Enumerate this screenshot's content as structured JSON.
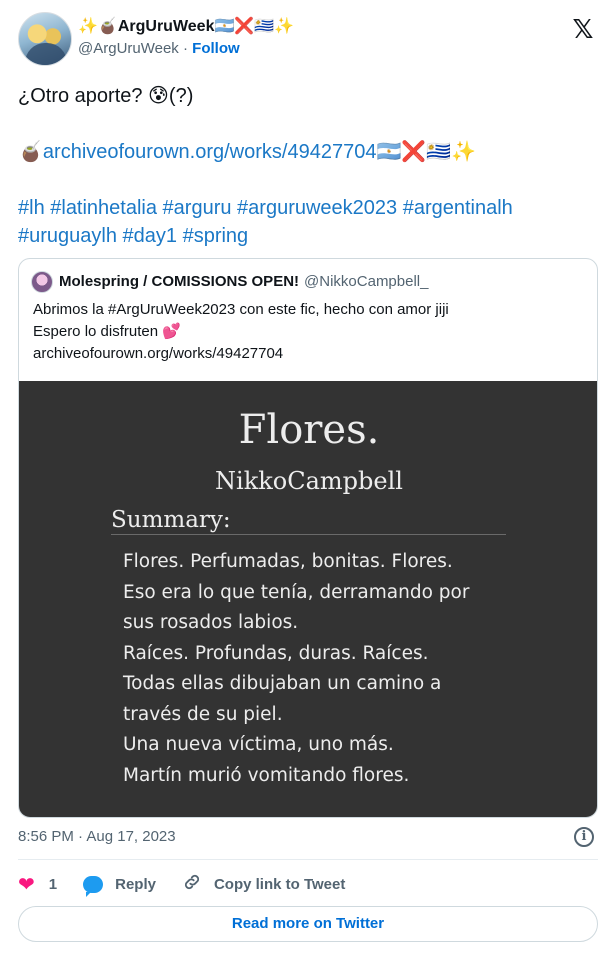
{
  "author": {
    "display_name": "✨🧉ArgUruWeek🇦🇷❌🇺🇾✨",
    "handle": "@ArgUruWeek",
    "separator": "·",
    "follow_label": "Follow"
  },
  "tweet": {
    "line1": "¿Otro aporte? 😰(?)",
    "link_prefix": "🧉",
    "link": "archiveofourown.org/works/49427704",
    "link_suffix": "🇦🇷❌🇺🇾✨",
    "hashtags_line1": "#lh #latinhetalia #arguru #arguruweek2023 #argentinalh",
    "hashtags_line2": "#uruguaylh #day1 #spring"
  },
  "quote": {
    "name": "Molespring / COMISSIONS OPEN!",
    "handle": "@NikkoCampbell_",
    "text_line1": "Abrimos la #ArgUruWeek2023 con este fic, hecho con amor jiji",
    "text_line2": "Espero lo disfruten 💕",
    "text_line3": "archiveofourown.org/works/49427704",
    "image": {
      "title": "Flores.",
      "author": "NikkoCampbell",
      "summary_label": "Summary:",
      "lines": [
        "Flores. Perfumadas, bonitas. Flores.",
        "Eso era lo que tenía, derramando por",
        "sus rosados labios.",
        "Raíces. Profundas, duras. Raíces.",
        "Todas ellas dibujaban un camino a",
        "través de su piel.",
        "Una nueva víctima, uno más.",
        "Martín murió vomitando flores."
      ]
    }
  },
  "meta": {
    "timestamp": "8:56 PM · Aug 17, 2023",
    "info_icon": "i"
  },
  "actions": {
    "like_count": "1",
    "reply_label": "Reply",
    "copy_label": "Copy link to Tweet"
  },
  "read_more_label": "Read more on Twitter",
  "icons": {
    "x_logo": "𝕏",
    "heart": "❤",
    "link": "🔗"
  },
  "colors": {
    "link": "#1b78c6",
    "follow": "#006fd6",
    "heart": "#f91880",
    "reply_bubble": "#1d9bf0",
    "image_bg": "#333333"
  }
}
